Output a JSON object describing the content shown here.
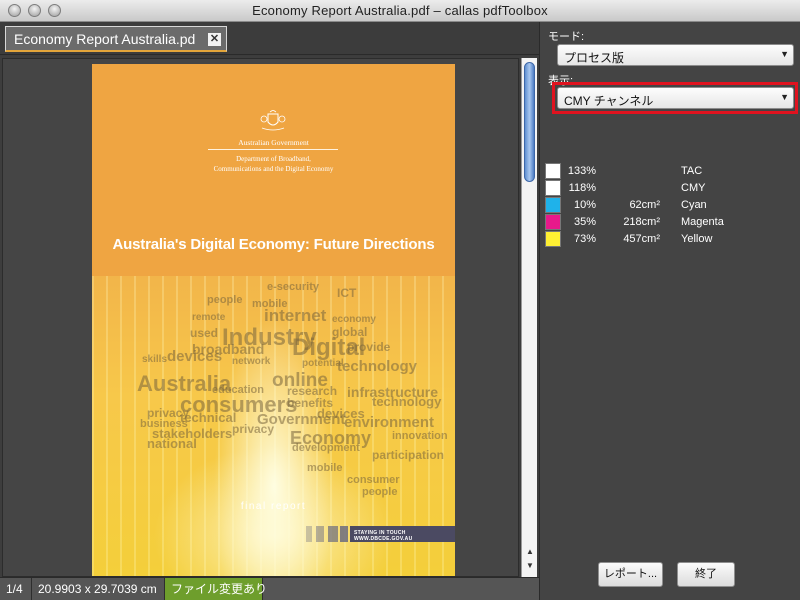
{
  "window": {
    "title": "Economy Report Australia.pdf – callas pdfToolbox"
  },
  "document_tab": {
    "label": "Economy Report Australia.pd",
    "close_glyph": "✕"
  },
  "pdf_page": {
    "gov_line1": "Australian Government",
    "gov_line2": "Department of Broadband,",
    "gov_line3": "Communications and the Digital Economy",
    "title": "Australia's Digital Economy: Future Directions",
    "subtitle": "final report",
    "footer_banner": "STAYING IN TOUCH  WWW.DBCDE.GOV.AU",
    "word_cloud": [
      "e-security",
      "ICT",
      "people",
      "mobile",
      "remote",
      "internet",
      "economy",
      "used",
      "Industry",
      "global",
      "broadband",
      "Digital",
      "provide",
      "skills",
      "devices",
      "technology",
      "Australia",
      "online",
      "research",
      "infrastructure",
      "consumers",
      "benefits",
      "technology",
      "privacy",
      "technical",
      "Government",
      "devices",
      "business",
      "stakeholders",
      "privacy",
      "environment",
      "national",
      "Economy",
      "innovation",
      "development",
      "participation",
      "mobile",
      "consumer",
      "people",
      "education",
      "network",
      "potential"
    ]
  },
  "status_bar": {
    "page": "1/4",
    "size": "20.9903 x 29.7039 cm",
    "modified": "ファイル変更あり"
  },
  "panel": {
    "mode_label": "モード:",
    "mode_value": "プロセス版",
    "view_label": "表示:",
    "view_value": "CMY チャンネル",
    "inks": [
      {
        "percent": "133%",
        "area": "",
        "name": "TAC",
        "color": "#ffffff"
      },
      {
        "percent": "118%",
        "area": "",
        "name": "CMY",
        "color": "#ffffff"
      },
      {
        "percent": "10%",
        "area": "62cm²",
        "name": "Cyan",
        "color": "#1fb2ea"
      },
      {
        "percent": "35%",
        "area": "218cm²",
        "name": "Magenta",
        "color": "#e8198b"
      },
      {
        "percent": "73%",
        "area": "457cm²",
        "name": "Yellow",
        "color": "#fff033"
      }
    ],
    "report_button": "レポート...",
    "close_button": "終了"
  },
  "colors": {
    "highlight": "#e0131f",
    "accent_tab": "#e3a53a",
    "modified_badge": "#6e9e2c"
  }
}
